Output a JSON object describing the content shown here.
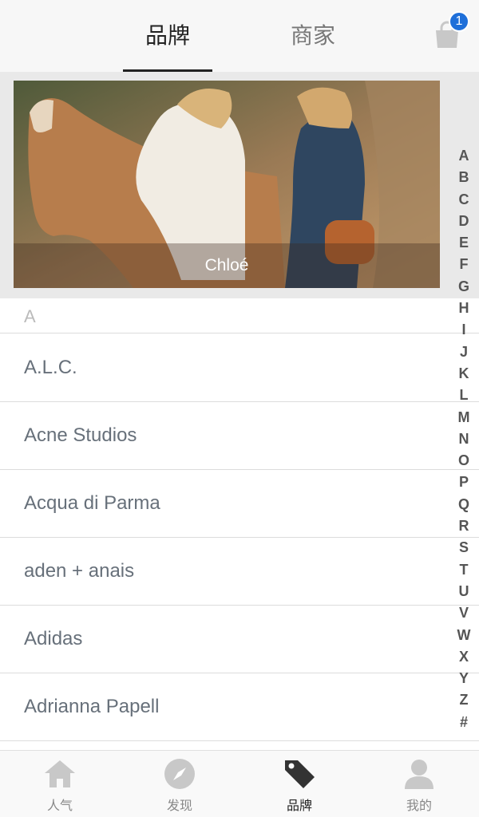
{
  "top_tabs": {
    "brand": "品牌",
    "merchant": "商家"
  },
  "cart": {
    "count": "1",
    "icon": "shopping-bag-icon"
  },
  "banner": {
    "caption": "Chloé"
  },
  "section": {
    "letter": "A"
  },
  "brands": [
    "A.L.C.",
    "Acne Studios",
    "Acqua di Parma",
    "aden + anais",
    "Adidas",
    "Adrianna Papell"
  ],
  "alphabet": [
    "A",
    "B",
    "C",
    "D",
    "E",
    "F",
    "G",
    "H",
    "I",
    "J",
    "K",
    "L",
    "M",
    "N",
    "O",
    "P",
    "Q",
    "R",
    "S",
    "T",
    "U",
    "V",
    "W",
    "X",
    "Y",
    "Z",
    "#"
  ],
  "bottom_nav": [
    {
      "label": "人气",
      "icon": "home-icon"
    },
    {
      "label": "发现",
      "icon": "compass-icon"
    },
    {
      "label": "品牌",
      "icon": "tag-icon"
    },
    {
      "label": "我的",
      "icon": "person-icon"
    }
  ],
  "colors": {
    "badge": "#1e6fd9",
    "active": "#222222",
    "inactive": "#888888"
  }
}
